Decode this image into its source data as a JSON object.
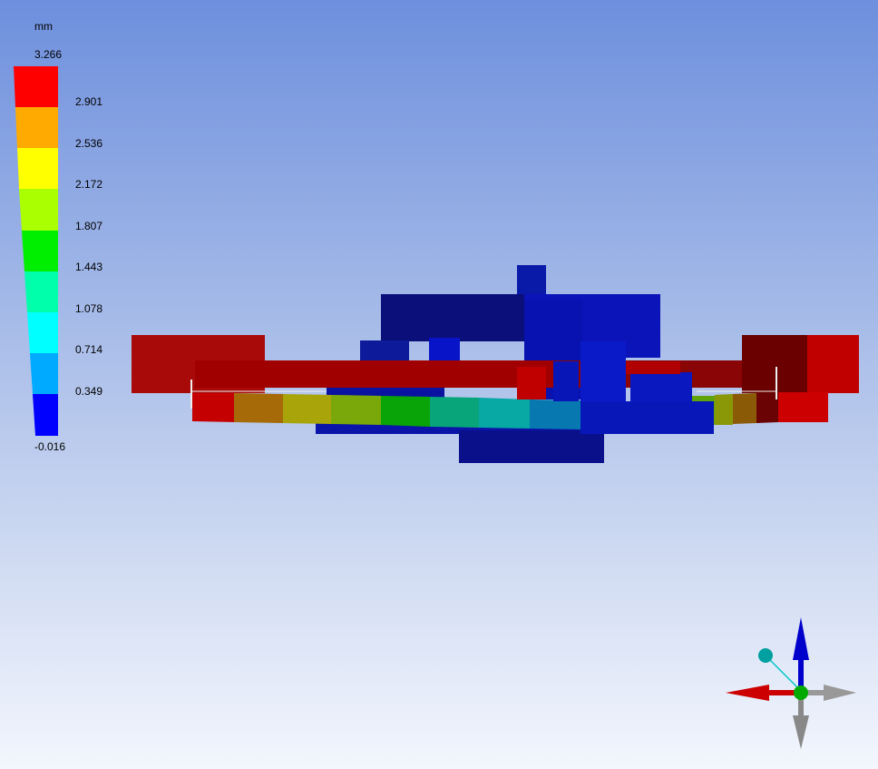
{
  "legend": {
    "unit": "mm",
    "max_label": "3.266",
    "min_label": "-0.016",
    "levels": [
      "2.901",
      "2.536",
      "2.172",
      "1.807",
      "1.443",
      "1.078",
      "0.714",
      "0.349"
    ],
    "band_colors": [
      "#ff0000",
      "#ffaa00",
      "#ffff00",
      "#aaff00",
      "#00ee00",
      "#00ffaa",
      "#00ffff",
      "#00aaff",
      "#0000ff"
    ]
  },
  "view": {
    "background_top": "#6d8fdd",
    "background_bottom": "#f3f6fd"
  },
  "triad": {
    "x_axis_color": "#cc0000",
    "y_axis_color": "#0000cc",
    "z_axis_color": "#888888",
    "origin_color": "#00aa00",
    "iso_ball_color": "#00a0a0"
  }
}
